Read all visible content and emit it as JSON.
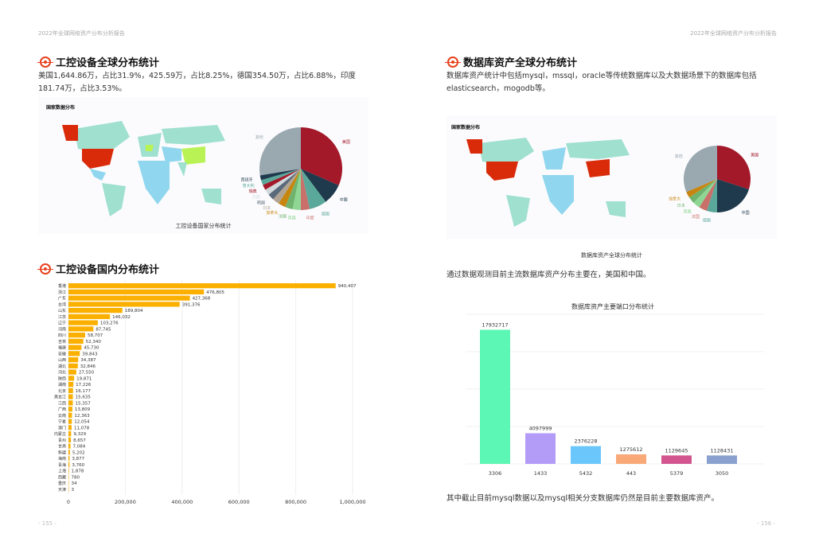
{
  "left_page": {
    "header": "2022年全球网络资产分布分析报告",
    "section1": {
      "title": "工控设备全球分布统计",
      "paragraph": "美国1,644.86万，占比31.9%，425.59万，占比8.25%，德国354.50万，占比6.88%，印度181.74万，占比3.53%。",
      "map_title": "国家数据分布",
      "caption": "工控设备国家分布统计",
      "pie": {
        "slices": [
          {
            "label": "美国",
            "value": 31.9,
            "color": "#a3192a"
          },
          {
            "label": "中国",
            "value": 8.25,
            "color": "#1f3a4d"
          },
          {
            "label": "德国",
            "value": 6.88,
            "color": "#5aa89a"
          },
          {
            "label": "印度",
            "value": 3.53,
            "color": "#c9706a"
          },
          {
            "label": "英国",
            "value": 3.2,
            "color": "#8fd694"
          },
          {
            "label": "法国",
            "value": 3.0,
            "color": "#6fb36f"
          },
          {
            "label": "加拿大",
            "value": 2.9,
            "color": "#c7860f"
          },
          {
            "label": "日本",
            "value": 2.7,
            "color": "#b0a595"
          },
          {
            "label": "韩国",
            "value": 2.5,
            "color": "#5a6a7a"
          },
          {
            "label": "巴西",
            "value": 2.3,
            "color": "#d0d8dc"
          },
          {
            "label": "瑞典",
            "value": 2.1,
            "color": "#a3192a"
          },
          {
            "label": "意大利",
            "value": 2.0,
            "color": "#5aa89a"
          },
          {
            "label": "西班牙",
            "value": 1.9,
            "color": "#1f3a4d"
          },
          {
            "label": "其他",
            "value": 27.84,
            "color": "#9aa8b0"
          }
        ]
      }
    },
    "section2": {
      "title": "工控设备国内分布统计",
      "chart_data": {
        "type": "bar",
        "orientation": "horizontal",
        "categories": [
          "香港",
          "浙江",
          "广东",
          "台湾",
          "山东",
          "江苏",
          "辽宁",
          "河南",
          "四川",
          "吉林",
          "福建",
          "安徽",
          "山西",
          "湖北",
          "河北",
          "陕西",
          "湖南",
          "北京",
          "黑龙江",
          "江西",
          "广西",
          "云南",
          "宁夏",
          "澳门",
          "内蒙古",
          "贵州",
          "甘肃",
          "新疆",
          "海南",
          "青海",
          "上海",
          "西藏",
          "重庆",
          "天津"
        ],
        "values": [
          940407,
          476805,
          427368,
          391376,
          189804,
          146032,
          103276,
          87745,
          58707,
          52340,
          45730,
          39843,
          34387,
          32846,
          27550,
          19871,
          17226,
          16177,
          15635,
          15357,
          13809,
          12363,
          12054,
          11078,
          9329,
          8657,
          7084,
          5202,
          3877,
          3760,
          1878,
          780,
          34,
          3
        ],
        "value_labels": [
          "940,407",
          "476,805",
          "427,368",
          "391,376",
          "189,804",
          "146,032",
          "103,276",
          "87,745",
          "58,707",
          "52,340",
          "45,730",
          "39,843",
          "34,387",
          "32,846",
          "27,550",
          "19,871",
          "17,226",
          "16,177",
          "15,635",
          "15,357",
          "13,809",
          "12,363",
          "12,054",
          "11,078",
          "9,329",
          "8,657",
          "7,084",
          "5,202",
          "3,877",
          "3,760",
          "1,878",
          "780",
          "34",
          "3"
        ],
        "xlim": [
          0,
          1000000
        ],
        "xticks": [
          "0",
          "200,000",
          "400,000",
          "600,000",
          "800,000",
          "1,000,000"
        ],
        "color": "#fbb000"
      }
    },
    "page_number": "- 155 -"
  },
  "right_page": {
    "header": "2022年全球网络资产分布分析报告",
    "section1": {
      "title": "数据库资产全球分布统计",
      "paragraph": "数据库资产统计中包括mysql，mssql，oracle等传统数据库以及大数据场景下的数据库包括elasticsearch，mogodb等。",
      "map_title": "国家数据分布",
      "caption": "数据库资产全球分布统计",
      "pie": {
        "slices": [
          {
            "label": "美国",
            "value": 30,
            "color": "#a3192a"
          },
          {
            "label": "中国",
            "value": 20,
            "color": "#1f3a4d"
          },
          {
            "label": "德国",
            "value": 5,
            "color": "#5aa89a"
          },
          {
            "label": "法国",
            "value": 4,
            "color": "#c9706a"
          },
          {
            "label": "英国",
            "value": 3.5,
            "color": "#8fd694"
          },
          {
            "label": "日本",
            "value": 3.2,
            "color": "#6fb36f"
          },
          {
            "label": "加拿大",
            "value": 3,
            "color": "#c7860f"
          },
          {
            "label": "其他",
            "value": 31.3,
            "color": "#9aa8b0"
          }
        ]
      }
    },
    "note1": "通过数据观测目前主流数据库资产分布主要在，美国和中国。",
    "chart_data": {
      "type": "bar",
      "title": "数据库资产主要端口分布统计",
      "categories": [
        "3306",
        "1433",
        "5432",
        "443",
        "5379",
        "3050"
      ],
      "values": [
        17932717,
        4097999,
        2376228,
        1275612,
        1129645,
        1128431
      ],
      "colors": [
        "#5cf7b4",
        "#b39cf8",
        "#6bc7fb",
        "#f9a977",
        "#d35590",
        "#8aa1cf"
      ],
      "ylim": [
        0,
        20000000
      ]
    },
    "note2": "其中截止目前mysql数据以及mysql相关分支数据库仍然是目前主要数据库资产。",
    "page_number": "- 156 -"
  }
}
